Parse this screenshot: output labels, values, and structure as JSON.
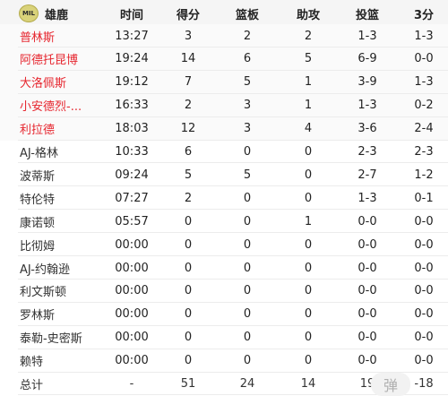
{
  "header": {
    "logo_text": "MIL",
    "team": "雄鹿",
    "columns": {
      "time": "时间",
      "pts": "得分",
      "reb": "篮板",
      "ast": "助攻",
      "fg": "投篮",
      "three": "3分"
    }
  },
  "colors": {
    "starter_name": "#e6262f",
    "header_bg": "#f5f5f5"
  },
  "starters": [
    {
      "name": "普林斯",
      "time": "13:27",
      "pts": "3",
      "reb": "2",
      "ast": "2",
      "fg": "1-3",
      "three": "1-3"
    },
    {
      "name": "阿德托昆博",
      "time": "19:24",
      "pts": "14",
      "reb": "6",
      "ast": "5",
      "fg": "6-9",
      "three": "0-0"
    },
    {
      "name": "大洛佩斯",
      "time": "19:12",
      "pts": "7",
      "reb": "5",
      "ast": "1",
      "fg": "3-9",
      "three": "1-3"
    },
    {
      "name": "小安德烈-...",
      "time": "16:33",
      "pts": "2",
      "reb": "3",
      "ast": "1",
      "fg": "1-3",
      "three": "0-2"
    },
    {
      "name": "利拉德",
      "time": "18:03",
      "pts": "12",
      "reb": "3",
      "ast": "4",
      "fg": "3-6",
      "three": "2-4"
    }
  ],
  "bench": [
    {
      "name": "AJ-格林",
      "time": "10:33",
      "pts": "6",
      "reb": "0",
      "ast": "0",
      "fg": "2-3",
      "three": "2-3"
    },
    {
      "name": "波蒂斯",
      "time": "09:24",
      "pts": "5",
      "reb": "5",
      "ast": "0",
      "fg": "2-7",
      "three": "1-2"
    },
    {
      "name": "特伦特",
      "time": "07:27",
      "pts": "2",
      "reb": "0",
      "ast": "0",
      "fg": "1-3",
      "three": "0-1"
    },
    {
      "name": "康诺顿",
      "time": "05:57",
      "pts": "0",
      "reb": "0",
      "ast": "1",
      "fg": "0-0",
      "three": "0-0"
    },
    {
      "name": "比彻姆",
      "time": "00:00",
      "pts": "0",
      "reb": "0",
      "ast": "0",
      "fg": "0-0",
      "three": "0-0"
    },
    {
      "name": "AJ-约翰逊",
      "time": "00:00",
      "pts": "0",
      "reb": "0",
      "ast": "0",
      "fg": "0-0",
      "three": "0-0"
    },
    {
      "name": "利文斯顿",
      "time": "00:00",
      "pts": "0",
      "reb": "0",
      "ast": "0",
      "fg": "0-0",
      "three": "0-0"
    },
    {
      "name": "罗林斯",
      "time": "00:00",
      "pts": "0",
      "reb": "0",
      "ast": "0",
      "fg": "0-0",
      "three": "0-0"
    },
    {
      "name": "泰勒-史密斯",
      "time": "00:00",
      "pts": "0",
      "reb": "0",
      "ast": "0",
      "fg": "0-0",
      "three": "0-0"
    },
    {
      "name": "赖特",
      "time": "00:00",
      "pts": "0",
      "reb": "0",
      "ast": "0",
      "fg": "0-0",
      "three": "0-0"
    }
  ],
  "total": {
    "name": "总计",
    "time": "-",
    "pts": "51",
    "reb": "24",
    "ast": "14",
    "fg": "19",
    "three": "-18"
  },
  "watermark": "弹"
}
